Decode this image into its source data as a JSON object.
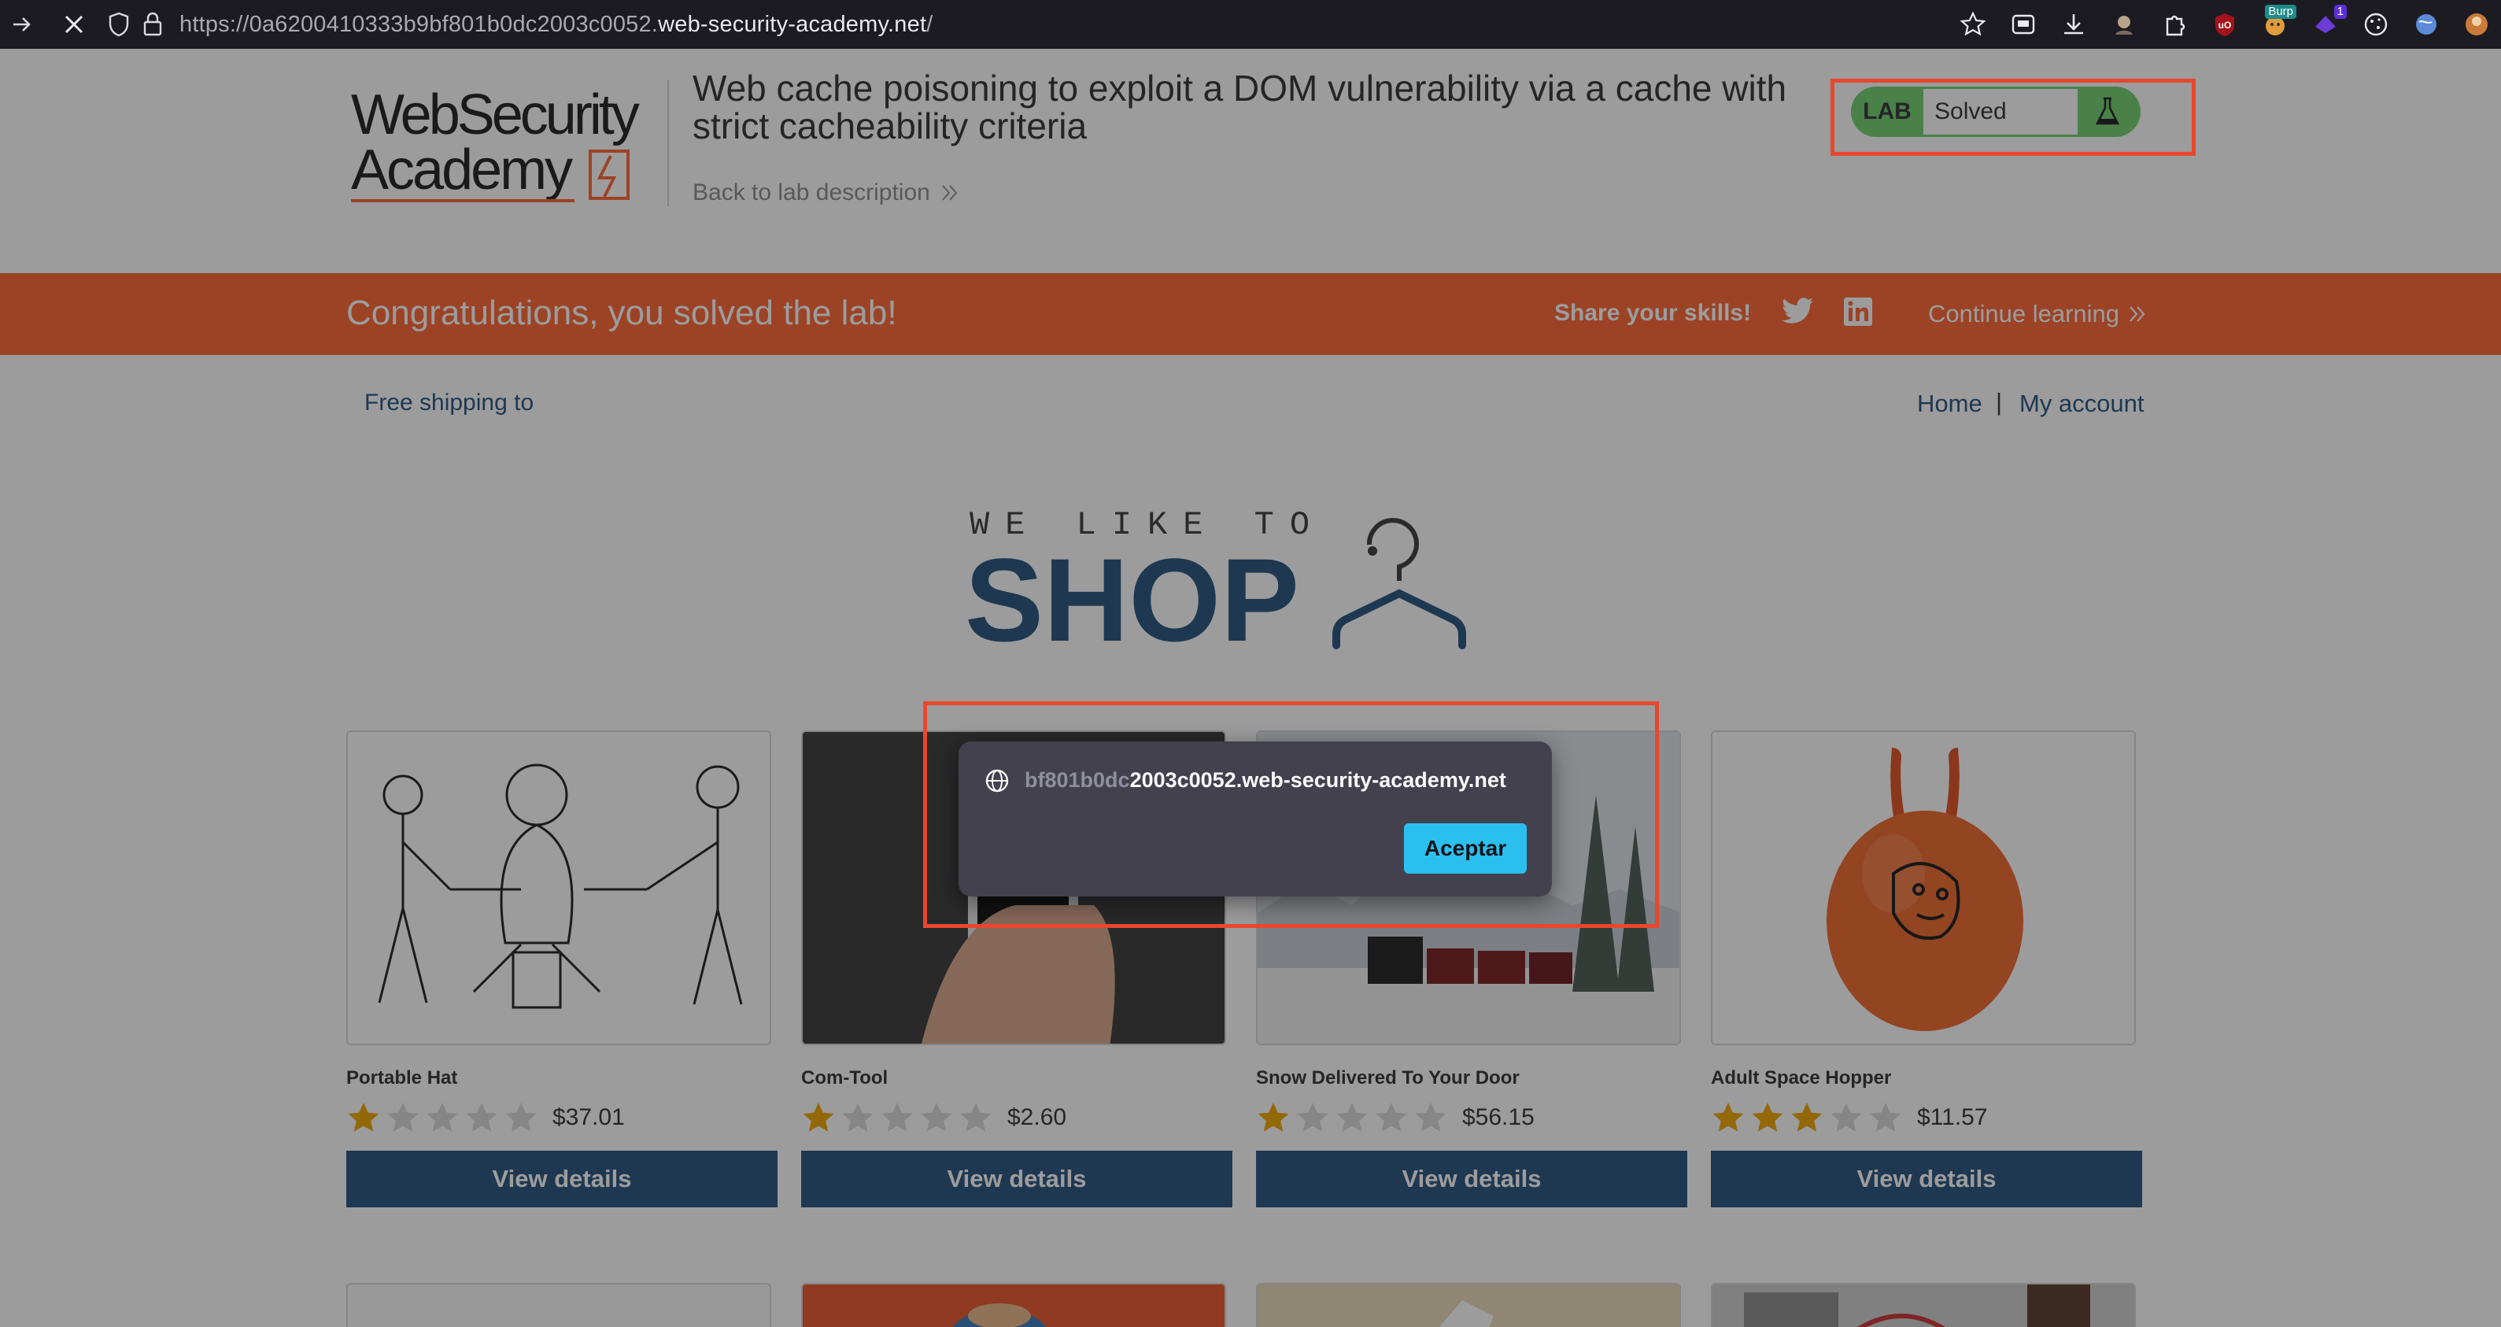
{
  "browser": {
    "url_prefix": "https://0a6200410333b9bf801b0dc2003c0052.",
    "url_domain": "web-security-academy.net",
    "url_suffix": "/",
    "extensions": [
      "bookmark-star-icon",
      "reader-icon",
      "download-icon",
      "avatar-ext-icon",
      "extensions-puzzle-icon",
      "ublock-icon",
      "burp-ext-icon",
      "purple-ext-icon",
      "cookie-icon",
      "globe-ext-icon",
      "profile-icon"
    ],
    "badge_burp": "Burp",
    "badge_purple": "1"
  },
  "header": {
    "logo_line1": "WebSecurity",
    "logo_line2": "Academy",
    "lab_title": "Web cache poisoning to exploit a DOM vulnerability via a cache with strict cacheability criteria",
    "back_link": "Back to lab description",
    "status_tag": "LAB",
    "status_value": "Solved"
  },
  "banner": {
    "message": "Congratulations, you solved the lab!",
    "share_label": "Share your skills!",
    "continue_label": "Continue learning"
  },
  "nav": {
    "free_shipping": "Free shipping to",
    "home": "Home",
    "separator": "|",
    "account": "My account"
  },
  "shop_logo": {
    "tagline": "WE LIKE TO",
    "word": "SHOP"
  },
  "products": [
    {
      "name": "Portable Hat",
      "rating": 1,
      "price": "$37.01",
      "button": "View details"
    },
    {
      "name": "Com-Tool",
      "rating": 1,
      "price": "$2.60",
      "button": "View details"
    },
    {
      "name": "Snow Delivered To Your Door",
      "rating": 1,
      "price": "$56.15",
      "button": "View details"
    },
    {
      "name": "Adult Space Hopper",
      "rating": 3,
      "price": "$11.57",
      "button": "View details"
    }
  ],
  "alert": {
    "origin_faded": "bf801b0dc",
    "origin_main": "2003c0052.web-security-academy.net",
    "ok_button": "Aceptar"
  },
  "colors": {
    "banner": "#ff6633",
    "button": "#29537d",
    "link": "#29537d",
    "lab_solved": "#70d16d",
    "alert_bg": "#42414d",
    "alert_button": "#2bbfee",
    "annotation": "#e8472e",
    "star_on": "#f0a500",
    "star_off": "#d9d9d9"
  }
}
